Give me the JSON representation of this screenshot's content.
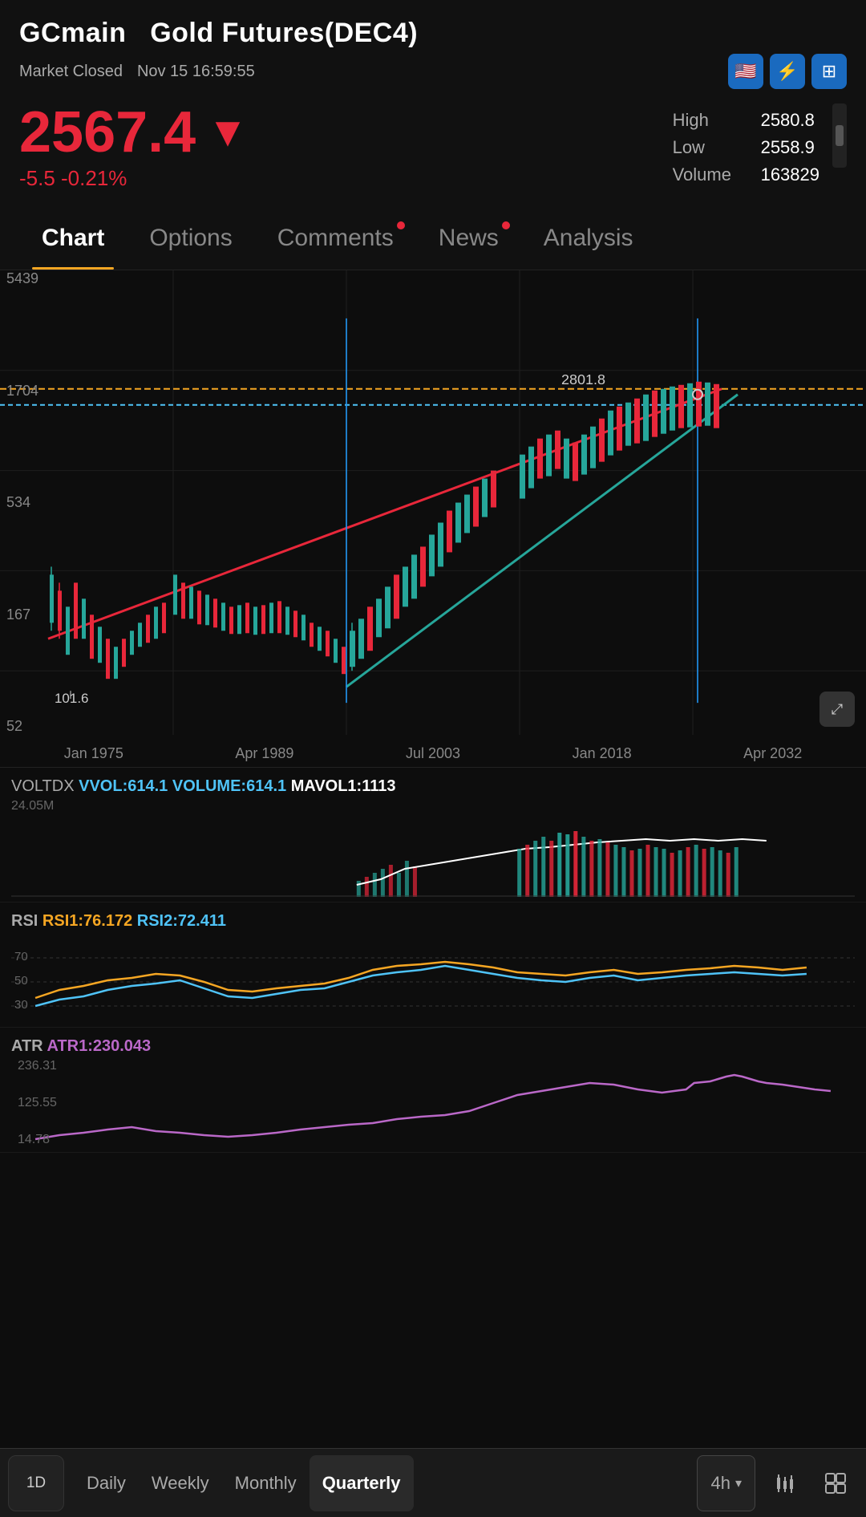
{
  "header": {
    "ticker": "GCmain",
    "instrument": "Gold Futures(DEC4)",
    "market_status": "Market Closed",
    "timestamp": "Nov 15 16:59:55",
    "price": "2567.4",
    "change": "-5.5 -0.21%",
    "high_label": "High",
    "high_value": "2580.8",
    "low_label": "Low",
    "low_value": "2558.9",
    "volume_label": "Volume",
    "volume_value": "163829"
  },
  "nav": {
    "tabs": [
      {
        "id": "chart",
        "label": "Chart",
        "active": true,
        "dot": false
      },
      {
        "id": "options",
        "label": "Options",
        "active": false,
        "dot": false
      },
      {
        "id": "comments",
        "label": "Comments",
        "active": false,
        "dot": true
      },
      {
        "id": "news",
        "label": "News",
        "active": false,
        "dot": true
      },
      {
        "id": "analysis",
        "label": "Analysis",
        "active": false,
        "dot": false
      }
    ]
  },
  "chart": {
    "y_labels": [
      "5439",
      "1704",
      "534",
      "167",
      "52"
    ],
    "x_labels": [
      "Jan 1975",
      "Apr 1989",
      "Jul 2003",
      "Jan 2018",
      "Apr 2032"
    ],
    "annotation_price": "2801.8",
    "annotation_low": "101.6"
  },
  "voltdx": {
    "label": "VOLTDX",
    "vvol_label": "VVOL:",
    "vvol_value": "614.1",
    "volume_label": "VOLUME:",
    "volume_value": "614.1",
    "mavol_label": "MAVOL1:",
    "mavol_value": "1113",
    "y_max": "24.05M"
  },
  "rsi": {
    "label": "RSI",
    "rsi1_label": "RSI1:",
    "rsi1_value": "76.172",
    "rsi2_label": "RSI2:",
    "rsi2_value": "72.411",
    "levels": [
      "70",
      "50",
      "30"
    ]
  },
  "atr": {
    "label": "ATR",
    "atr1_label": "ATR1:",
    "atr1_value": "230.043",
    "y_labels": [
      "236.31",
      "125.55",
      "14.78"
    ]
  },
  "toolbar": {
    "timeframe_icon": "1D",
    "periods": [
      "Daily",
      "Weekly",
      "Monthly",
      "Quarterly"
    ],
    "active_period": "Quarterly",
    "right_period": "4h",
    "icons": [
      "chart-icon",
      "grid-icon"
    ]
  },
  "colors": {
    "accent_red": "#e8273a",
    "accent_orange": "#f5a623",
    "accent_blue": "#1a6abf",
    "price_red": "#e8273a",
    "up_green": "#26a69a",
    "down_red": "#e8273a",
    "line_orange": "#f5a623",
    "line_blue": "#4fc3f7",
    "line_purple": "#ba68c8"
  }
}
